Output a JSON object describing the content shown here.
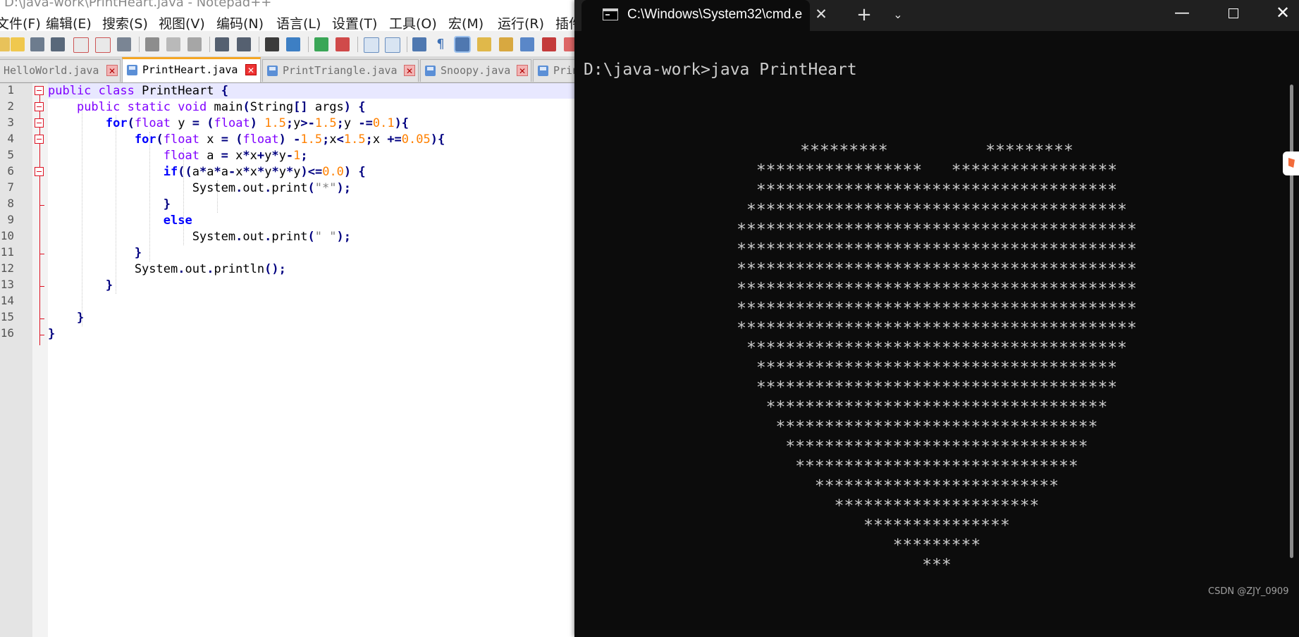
{
  "npp": {
    "title": "D:\\java-work\\PrintHeart.java - Notepad++",
    "menu": [
      "文件(F)",
      "编辑(E)",
      "搜索(S)",
      "视图(V)",
      "编码(N)",
      "语言(L)",
      "设置(T)",
      "工具(O)",
      "宏(M)",
      "运行(R)",
      "插件"
    ],
    "tabs": [
      {
        "label": "HelloWorld.java",
        "active": false
      },
      {
        "label": "PrintHeart.java",
        "active": true
      },
      {
        "label": "PrintTriangle.java",
        "active": false
      },
      {
        "label": "Snoopy.java",
        "active": false
      },
      {
        "label": "PrintStar.java",
        "active": false
      }
    ],
    "line_numbers": [
      "1",
      "2",
      "3",
      "4",
      "5",
      "6",
      "7",
      "8",
      "9",
      "10",
      "11",
      "12",
      "13",
      "14",
      "15",
      "16"
    ]
  },
  "cmd": {
    "tab_title": "C:\\Windows\\System32\\cmd.e",
    "new_tab": "+",
    "dropdown": "⌄",
    "minimize": "—",
    "close_tab": "✕",
    "close_window": "✕",
    "prompt": "D:\\java-work>java PrintHeart",
    "heart": [
      "*********          *********",
      "*****************   *****************",
      "*************************************",
      "***************************************",
      "*****************************************",
      "*****************************************",
      "*****************************************",
      "*****************************************",
      "*****************************************",
      "*****************************************",
      "***************************************",
      "*************************************",
      "*************************************",
      "***********************************",
      "*********************************",
      "*******************************",
      "*****************************",
      "*************************",
      "*********************",
      "***************",
      "*********",
      "***"
    ]
  },
  "watermark": "CSDN @ZJY_0909"
}
